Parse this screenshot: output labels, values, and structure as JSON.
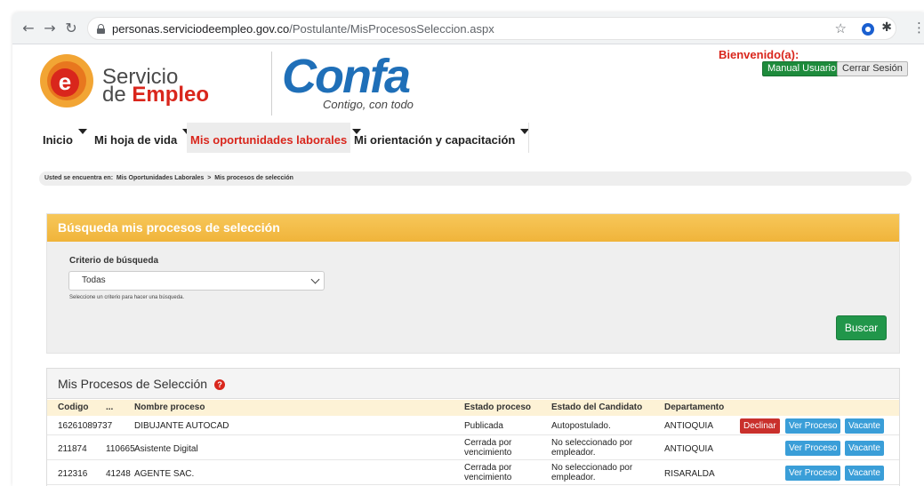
{
  "browser": {
    "url_host": "personas.serviciodeempleo.gov.co",
    "url_path": "/Postulante/MisProcesosSeleccion.aspx"
  },
  "header": {
    "logo_line1": "Servicio",
    "logo_line2_prefix": "de ",
    "logo_line2_highlight": "Empleo",
    "partner_logo": "Confa",
    "partner_tagline": "Contigo, con todo",
    "welcome": "Bienvenido(a):",
    "manual_button": "Manual Usuario",
    "logout_button": "Cerrar Sesión"
  },
  "menu": [
    {
      "label": "Inicio"
    },
    {
      "label": "Mi hoja de vida"
    },
    {
      "label": "Mis oportunidades laborales"
    },
    {
      "label": "Mi orientación y capacitación"
    }
  ],
  "breadcrumb": {
    "prefix": "Usted se encuentra en:",
    "level1": "Mis Oportunidades Laborales",
    "separator": ">",
    "level2": "Mis procesos de selección"
  },
  "search": {
    "title": "Búsqueda mis procesos de selección",
    "criterion_label": "Criterio de búsqueda",
    "selected_option": "Todas",
    "help_text": "Seleccione un criterio para hacer una búsqueda.",
    "search_button": "Buscar"
  },
  "results": {
    "title": "Mis Procesos de Selección",
    "help_icon_glyph": "?",
    "columns": {
      "codigo": "Codigo",
      "dots": "...",
      "nombre": "Nombre proceso",
      "estado_proceso": "Estado proceso",
      "estado_candidato": "Estado del Candidato",
      "departamento": "Departamento"
    },
    "rows": [
      {
        "codigo": "16261089737",
        "num": "",
        "nombre": "DIBUJANTE AUTOCAD",
        "estado_proceso_1": "Publicada",
        "estado_proceso_2": "",
        "estado_candidato_1": "Autopostulado.",
        "estado_candidato_2": "",
        "departamento": "ANTIOQUIA",
        "declinar": "Declinar",
        "ver": "Ver Proceso",
        "vacante": "Vacante"
      },
      {
        "codigo": "211874",
        "num": "110665",
        "nombre": "Asistente Digital",
        "estado_proceso_1": "Cerrada por",
        "estado_proceso_2": "vencimiento",
        "estado_candidato_1": "No seleccionado por",
        "estado_candidato_2": "empleador.",
        "departamento": "ANTIOQUIA",
        "ver": "Ver Proceso",
        "vacante": "Vacante"
      },
      {
        "codigo": "212316",
        "num": "41248",
        "nombre": "AGENTE SAC.",
        "estado_proceso_1": "Cerrada por",
        "estado_proceso_2": "vencimiento",
        "estado_candidato_1": "No seleccionado por",
        "estado_candidato_2": "empleador.",
        "departamento": "RISARALDA",
        "ver": "Ver Proceso",
        "vacante": "Vacante"
      }
    ]
  },
  "colors": {
    "brand_red": "#d9261c",
    "confa_blue": "#1f6fb8",
    "panel_yellow": "#f0b43a",
    "button_green": "#21964a",
    "button_blue": "#3a9ed8"
  }
}
